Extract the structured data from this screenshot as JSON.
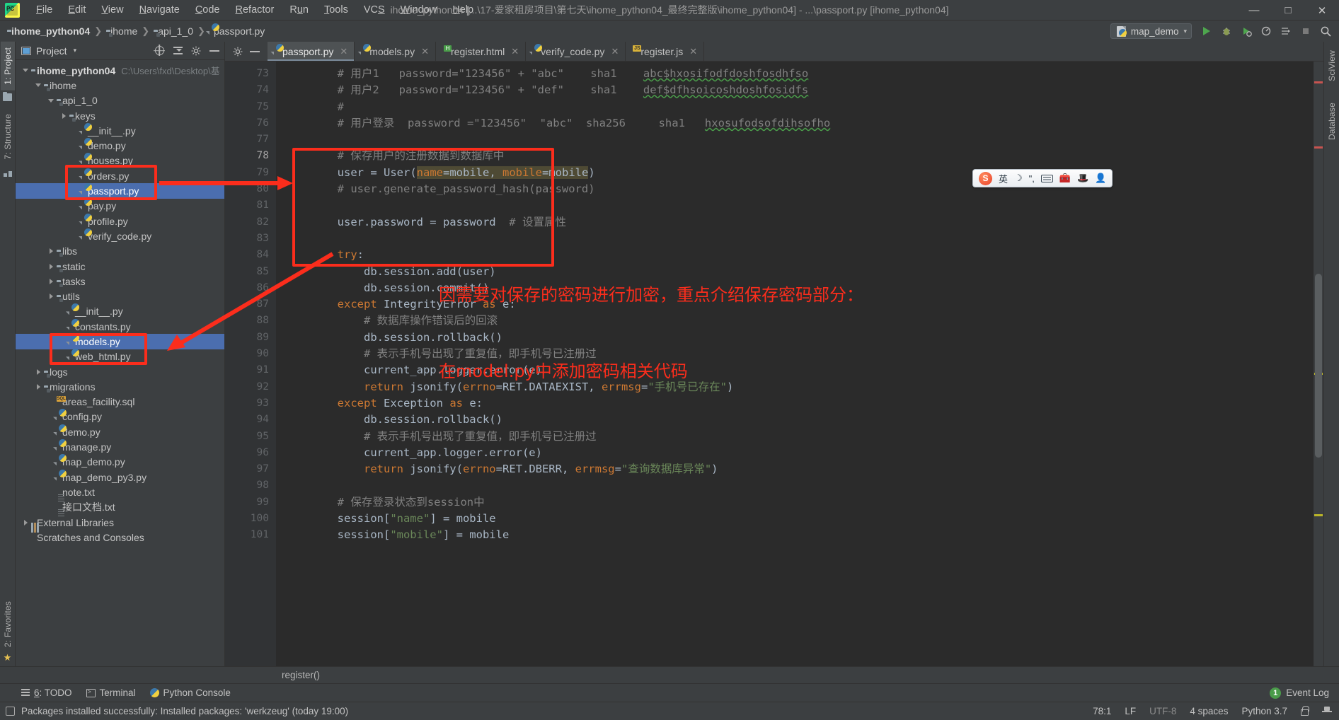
{
  "window": {
    "title": "ihome_python04 [...\\17-爱家租房项目\\第七天\\ihome_python04_最终完整版\\ihome_python04] - ...\\passport.py [ihome_python04]",
    "minimize": "—",
    "maximize": "□",
    "close": "✕",
    "logo_text": "PC"
  },
  "menubar": [
    {
      "label": "File"
    },
    {
      "label": "Edit"
    },
    {
      "label": "View"
    },
    {
      "label": "Navigate"
    },
    {
      "label": "Code"
    },
    {
      "label": "Refactor"
    },
    {
      "label": "Run"
    },
    {
      "label": "Tools"
    },
    {
      "label": "VCS"
    },
    {
      "label": "Window"
    },
    {
      "label": "Help"
    }
  ],
  "breadcrumbs": [
    {
      "label": "ihome_python04",
      "icon": "folder-icon"
    },
    {
      "label": "ihome",
      "icon": "source-folder-icon"
    },
    {
      "label": "api_1_0",
      "icon": "source-folder-icon"
    },
    {
      "label": "passport.py",
      "icon": "python-file-icon"
    }
  ],
  "toolbar": {
    "run_config": "map_demo",
    "run_config_caret": "▾",
    "buttons": [
      {
        "name": "run-button",
        "glyph": "▶"
      },
      {
        "name": "debug-button",
        "glyph": "🐞"
      },
      {
        "name": "run-with-coverage-button",
        "glyph": "▶"
      },
      {
        "name": "profile-button",
        "glyph": "◎"
      },
      {
        "name": "attach-button",
        "glyph": "⇥"
      },
      {
        "name": "stop-button",
        "glyph": "■"
      },
      {
        "name": "search-everywhere-button",
        "glyph": "🔍"
      }
    ]
  },
  "left_strip": {
    "tabs": [
      {
        "label": "1: Project",
        "active": true
      },
      {
        "label": "7: Structure",
        "active": false
      },
      {
        "label": "2: Favorites",
        "active": false
      }
    ]
  },
  "right_strip": {
    "tabs": [
      {
        "label": "SciView"
      },
      {
        "label": "Database"
      }
    ]
  },
  "project_panel": {
    "title": "Project",
    "title_caret": "▾",
    "icons": [
      "locate-icon",
      "collapse-all-icon",
      "settings-icon",
      "hide-icon"
    ],
    "tree": [
      {
        "indent": 0,
        "arrow": "down",
        "icon": "folder-icon",
        "label": "ihome_python04",
        "bold": true,
        "path": "C:\\Users\\fxd\\Desktop\\基"
      },
      {
        "indent": 1,
        "arrow": "down",
        "icon": "source-folder-icon",
        "label": "ihome"
      },
      {
        "indent": 2,
        "arrow": "down",
        "icon": "source-folder-icon",
        "label": "api_1_0"
      },
      {
        "indent": 3,
        "arrow": "right",
        "icon": "source-folder-icon",
        "label": "keys"
      },
      {
        "indent": 4,
        "arrow": "none",
        "icon": "python-file-icon",
        "label": "__init__.py"
      },
      {
        "indent": 4,
        "arrow": "none",
        "icon": "python-file-icon",
        "label": "demo.py"
      },
      {
        "indent": 4,
        "arrow": "none",
        "icon": "python-file-icon",
        "label": "houses.py"
      },
      {
        "indent": 4,
        "arrow": "none",
        "icon": "python-file-icon",
        "label": "orders.py"
      },
      {
        "indent": 4,
        "arrow": "none",
        "icon": "python-file-icon",
        "label": "passport.py",
        "selected": true
      },
      {
        "indent": 4,
        "arrow": "none",
        "icon": "python-file-icon",
        "label": "pay.py"
      },
      {
        "indent": 4,
        "arrow": "none",
        "icon": "python-file-icon",
        "label": "profile.py"
      },
      {
        "indent": 4,
        "arrow": "none",
        "icon": "python-file-icon",
        "label": "verify_code.py"
      },
      {
        "indent": 2,
        "arrow": "right",
        "icon": "source-folder-icon",
        "label": "libs"
      },
      {
        "indent": 2,
        "arrow": "right",
        "icon": "source-folder-icon",
        "label": "static"
      },
      {
        "indent": 2,
        "arrow": "right",
        "icon": "source-folder-icon",
        "label": "tasks"
      },
      {
        "indent": 2,
        "arrow": "right",
        "icon": "source-folder-icon",
        "label": "utils"
      },
      {
        "indent": 3,
        "arrow": "none",
        "icon": "python-file-icon",
        "label": "__init__.py"
      },
      {
        "indent": 3,
        "arrow": "none",
        "icon": "python-file-icon",
        "label": "constants.py"
      },
      {
        "indent": 3,
        "arrow": "none",
        "icon": "python-file-icon",
        "label": "models.py",
        "selected": true
      },
      {
        "indent": 3,
        "arrow": "none",
        "icon": "python-file-icon",
        "label": "web_html.py"
      },
      {
        "indent": 1,
        "arrow": "right",
        "icon": "source-folder-icon",
        "label": "logs"
      },
      {
        "indent": 1,
        "arrow": "right",
        "icon": "source-folder-icon",
        "label": "migrations"
      },
      {
        "indent": 2,
        "arrow": "none",
        "icon": "sql-file-icon",
        "label": "areas_facility.sql"
      },
      {
        "indent": 2,
        "arrow": "none",
        "icon": "python-file-icon",
        "label": "config.py"
      },
      {
        "indent": 2,
        "arrow": "none",
        "icon": "python-file-icon",
        "label": "demo.py"
      },
      {
        "indent": 2,
        "arrow": "none",
        "icon": "python-file-icon",
        "label": "manage.py"
      },
      {
        "indent": 2,
        "arrow": "none",
        "icon": "python-file-icon",
        "label": "map_demo.py"
      },
      {
        "indent": 2,
        "arrow": "none",
        "icon": "python-file-icon",
        "label": "map_demo_py3.py"
      },
      {
        "indent": 2,
        "arrow": "none",
        "icon": "text-file-icon",
        "label": "note.txt"
      },
      {
        "indent": 2,
        "arrow": "none",
        "icon": "text-file-icon",
        "label": "接口文档.txt"
      },
      {
        "indent": 0,
        "arrow": "right",
        "icon": "library-icon",
        "label": "External Libraries"
      },
      {
        "indent": 0,
        "arrow": "none",
        "icon": "scratch-icon",
        "label": "Scratches and Consoles"
      }
    ]
  },
  "editor": {
    "tabs": [
      {
        "label": "passport.py",
        "icon": "python-file-icon",
        "active": true,
        "close": "✕"
      },
      {
        "label": "models.py",
        "icon": "python-file-icon",
        "active": false,
        "close": "✕"
      },
      {
        "label": "register.html",
        "icon": "html-file-icon",
        "active": false,
        "close": "✕"
      },
      {
        "label": "verify_code.py",
        "icon": "python-file-icon",
        "active": false,
        "close": "✕"
      },
      {
        "label": "register.js",
        "icon": "js-file-icon",
        "active": false,
        "close": "✕"
      }
    ],
    "first_line": 73,
    "lines": [
      {
        "n": 73,
        "fold": "none",
        "tokens": [
          {
            "t": "        # 用户1   password=\"123456\" + \"abc\"    sha1    ",
            "c": "cm"
          },
          {
            "t": "abc$hxosifodfdoshfosdhfso",
            "c": "cm sq"
          }
        ]
      },
      {
        "n": 74,
        "fold": "none",
        "tokens": [
          {
            "t": "        # 用户2   password=\"123456\" + \"def\"    sha1    ",
            "c": "cm"
          },
          {
            "t": "def$dfhsoicoshdoshfosidfs",
            "c": "cm sq"
          }
        ]
      },
      {
        "n": 75,
        "fold": "none",
        "tokens": [
          {
            "t": "        #",
            "c": "cm"
          }
        ]
      },
      {
        "n": 76,
        "fold": "none",
        "tokens": [
          {
            "t": "        # 用户登录  password =\"123456\"  \"abc\"  sha256     sha1   ",
            "c": "cm"
          },
          {
            "t": "hxosufodsofdihsofho",
            "c": "cm sq"
          }
        ]
      },
      {
        "n": 77,
        "fold": "none",
        "tokens": [
          {
            "t": "",
            "c": "cm"
          }
        ]
      },
      {
        "n": 78,
        "fold": "start",
        "tokens": [
          {
            "t": "        # 保存用户的注册数据到数据库中",
            "c": "cm"
          }
        ]
      },
      {
        "n": 79,
        "fold": "none",
        "tokens": [
          {
            "t": "        user = ",
            "c": "id"
          },
          {
            "t": "User",
            "c": "id"
          },
          {
            "t": "(",
            "c": "id"
          },
          {
            "t": "name",
            "c": "kw hl-arg"
          },
          {
            "t": "=",
            "c": "id hl-arg"
          },
          {
            "t": "mobile, ",
            "c": "id hl-arg"
          },
          {
            "t": "mobile",
            "c": "kw hl-arg"
          },
          {
            "t": "=",
            "c": "id hl-arg"
          },
          {
            "t": "mobile",
            "c": "id hl-arg"
          },
          {
            "t": ")",
            "c": "id"
          }
        ]
      },
      {
        "n": 80,
        "fold": "none",
        "tokens": [
          {
            "t": "        # user.generate_password_hash(password)",
            "c": "cm"
          }
        ]
      },
      {
        "n": 81,
        "fold": "none",
        "tokens": [
          {
            "t": "",
            "c": "id"
          }
        ]
      },
      {
        "n": 82,
        "fold": "none",
        "tokens": [
          {
            "t": "        user.password = password",
            "c": "id"
          },
          {
            "t": "  # 设置属性",
            "c": "cm"
          }
        ]
      },
      {
        "n": 83,
        "fold": "none",
        "tokens": [
          {
            "t": "",
            "c": "id"
          }
        ]
      },
      {
        "n": 84,
        "fold": "open",
        "tokens": [
          {
            "t": "        ",
            "c": "id"
          },
          {
            "t": "try",
            "c": "kw"
          },
          {
            "t": ":",
            "c": "id"
          }
        ]
      },
      {
        "n": 85,
        "fold": "none",
        "tokens": [
          {
            "t": "            db.session.add(user)",
            "c": "id"
          }
        ]
      },
      {
        "n": 86,
        "fold": "end",
        "tokens": [
          {
            "t": "            db.session.commit()",
            "c": "id"
          }
        ]
      },
      {
        "n": 87,
        "fold": "open",
        "tokens": [
          {
            "t": "        ",
            "c": "id"
          },
          {
            "t": "except",
            "c": "kw"
          },
          {
            "t": " IntegrityError ",
            "c": "id"
          },
          {
            "t": "as",
            "c": "kw"
          },
          {
            "t": " e:",
            "c": "id"
          }
        ]
      },
      {
        "n": 88,
        "fold": "none",
        "tokens": [
          {
            "t": "            # 数据库操作错误后的回滚",
            "c": "cm"
          }
        ]
      },
      {
        "n": 89,
        "fold": "none",
        "tokens": [
          {
            "t": "            db.session.rollback()",
            "c": "id"
          }
        ]
      },
      {
        "n": 90,
        "fold": "none",
        "tokens": [
          {
            "t": "            # 表示手机号出现了重复值，即手机号已注册过",
            "c": "cm"
          }
        ]
      },
      {
        "n": 91,
        "fold": "none",
        "tokens": [
          {
            "t": "            current_app.logger.error(e)",
            "c": "id"
          }
        ]
      },
      {
        "n": 92,
        "fold": "end",
        "tokens": [
          {
            "t": "            ",
            "c": "id"
          },
          {
            "t": "return",
            "c": "kw"
          },
          {
            "t": " jsonify(",
            "c": "id"
          },
          {
            "t": "errno",
            "c": "par"
          },
          {
            "t": "=RET.DATAEXIST, ",
            "c": "id"
          },
          {
            "t": "errmsg",
            "c": "par"
          },
          {
            "t": "=",
            "c": "id"
          },
          {
            "t": "\"手机号已存在\"",
            "c": "st"
          },
          {
            "t": ")",
            "c": "id"
          }
        ]
      },
      {
        "n": 93,
        "fold": "open",
        "tokens": [
          {
            "t": "        ",
            "c": "id"
          },
          {
            "t": "except",
            "c": "kw"
          },
          {
            "t": " Exception ",
            "c": "id"
          },
          {
            "t": "as",
            "c": "kw"
          },
          {
            "t": " e:",
            "c": "id"
          }
        ]
      },
      {
        "n": 94,
        "fold": "none",
        "tokens": [
          {
            "t": "            db.session.rollback()",
            "c": "id"
          }
        ]
      },
      {
        "n": 95,
        "fold": "none",
        "tokens": [
          {
            "t": "            # 表示手机号出现了重复值，即手机号已注册过",
            "c": "cm"
          }
        ]
      },
      {
        "n": 96,
        "fold": "none",
        "tokens": [
          {
            "t": "            current_app.logger.error(e)",
            "c": "id"
          }
        ]
      },
      {
        "n": 97,
        "fold": "end",
        "tokens": [
          {
            "t": "            ",
            "c": "id"
          },
          {
            "t": "return",
            "c": "kw"
          },
          {
            "t": " jsonify(",
            "c": "id"
          },
          {
            "t": "errno",
            "c": "par"
          },
          {
            "t": "=RET.DBERR, ",
            "c": "id"
          },
          {
            "t": "errmsg",
            "c": "par"
          },
          {
            "t": "=",
            "c": "id"
          },
          {
            "t": "\"查询数据库异常\"",
            "c": "st"
          },
          {
            "t": ")",
            "c": "id"
          }
        ]
      },
      {
        "n": 98,
        "fold": "none",
        "tokens": [
          {
            "t": "",
            "c": "id"
          }
        ]
      },
      {
        "n": 99,
        "fold": "none",
        "tokens": [
          {
            "t": "        # 保存登录状态到session中",
            "c": "cm"
          }
        ]
      },
      {
        "n": 100,
        "fold": "none",
        "tokens": [
          {
            "t": "        session[",
            "c": "id"
          },
          {
            "t": "\"name\"",
            "c": "st"
          },
          {
            "t": "] = mobile",
            "c": "id"
          }
        ]
      },
      {
        "n": 101,
        "fold": "none",
        "tokens": [
          {
            "t": "        session[",
            "c": "id"
          },
          {
            "t": "\"mobile\"",
            "c": "st"
          },
          {
            "t": "] = mobile",
            "c": "id"
          }
        ]
      }
    ],
    "breadcrumb_function": "register()"
  },
  "annotations": {
    "note_line1": "因需要对保存的密码进行加密，重点介绍保存密码部分：",
    "note_line2": "在model.py中添加密码相关代码"
  },
  "ime": {
    "logo": "S",
    "mode": "英",
    "moon": "☽",
    "punct": "\",",
    "keyboard": "keyboard-icon",
    "toolbox": "toolbox-icon",
    "hat": "hat-icon",
    "person": "person-icon"
  },
  "toolwindow_bar": {
    "items": [
      {
        "label": "6: TODO",
        "icon": "todo-icon"
      },
      {
        "label": "Terminal",
        "icon": "terminal-icon"
      },
      {
        "label": "Python Console",
        "icon": "python-console-icon"
      }
    ],
    "event_log": "Event Log",
    "event_badge": "1"
  },
  "statusbar": {
    "message": "Packages installed successfully: Installed packages: 'werkzeug' (today 19:00)",
    "caret": "78:1",
    "line_sep": "LF",
    "encoding": "UTF-8",
    "indent": "4 spaces",
    "interpreter": "Python 3.7"
  },
  "colors": {
    "accent_red": "#fb2d1c",
    "selection_blue": "#4b6eaf",
    "panel_bg": "#3c3f41",
    "editor_bg": "#2b2b2b"
  }
}
